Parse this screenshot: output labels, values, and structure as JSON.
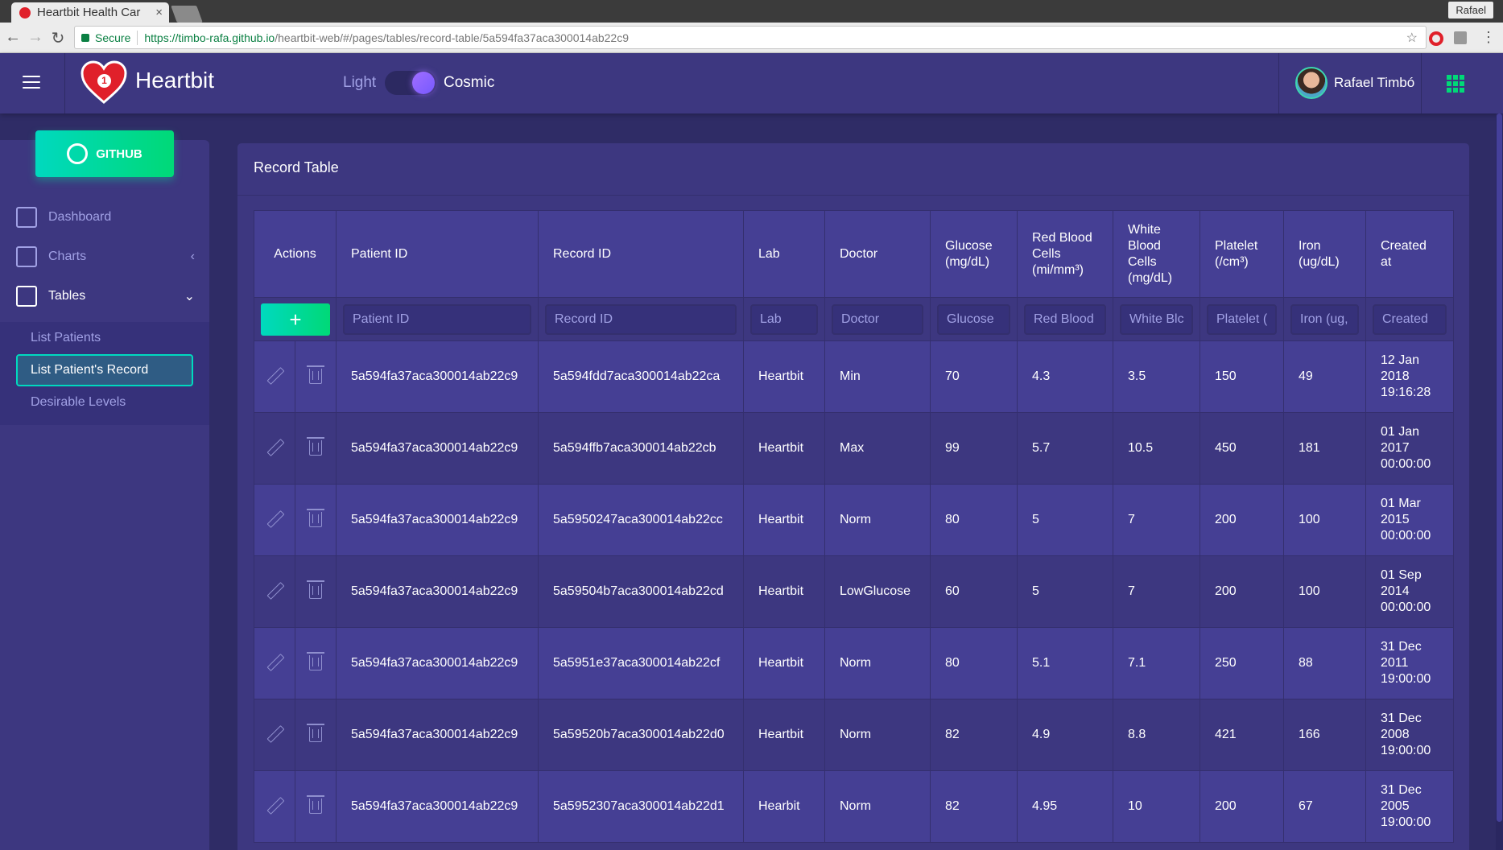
{
  "browser": {
    "tab_title": "Heartbit Health Car",
    "profile_name": "Rafael",
    "secure_label": "Secure",
    "url_origin": "https://timbo-rafa.github.io",
    "url_path": "/heartbit-web/#/pages/tables/record-table/5a594fa37aca300014ab22c9"
  },
  "header": {
    "brand": "Heartbit",
    "logo_badge": "1",
    "theme_light_label": "Light",
    "theme_cosmic_label": "Cosmic",
    "theme_selected": "Cosmic",
    "user_name": "Rafael Timbó",
    "accent_color": "#00d977"
  },
  "sidebar": {
    "github_label": "GITHUB",
    "items": [
      {
        "label": "Dashboard",
        "icon": "home-icon"
      },
      {
        "label": "Charts",
        "icon": "bar-chart-icon",
        "chevron": "‹"
      },
      {
        "label": "Tables",
        "icon": "table-icon",
        "chevron": "⌄"
      }
    ],
    "subitems": [
      {
        "label": "List Patients"
      },
      {
        "label": "List Patient's Record"
      },
      {
        "label": "Desirable Levels"
      }
    ]
  },
  "card": {
    "title": "Record Table"
  },
  "table": {
    "headers": {
      "actions": "Actions",
      "patient_id": "Patient ID",
      "record_id": "Record ID",
      "lab": "Lab",
      "doctor": "Doctor",
      "glucose": "Glucose (mg/dL)",
      "rbc": "Red Blood Cells (mi/mm³)",
      "wbc": "White Blood Cells (mg/dL)",
      "platelet": "Platelet (/cm³)",
      "iron": "Iron (ug/dL)",
      "created": "Created at"
    },
    "add_label": "+",
    "placeholders": {
      "patient_id": "Patient ID",
      "record_id": "Record ID",
      "lab": "Lab",
      "doctor": "Doctor",
      "glucose": "Glucose",
      "rbc": "Red Blood",
      "wbc": "White Blc",
      "platelet": "Platelet (",
      "iron": "Iron (ug,",
      "created": "Created"
    },
    "rows": [
      {
        "patient_id": "5a594fa37aca300014ab22c9",
        "record_id": "5a594fdd7aca300014ab22ca",
        "lab": "Heartbit",
        "doctor": "Min",
        "glucose": "70",
        "rbc": "4.3",
        "wbc": "3.5",
        "platelet": "150",
        "iron": "49",
        "created": "12 Jan 2018 19:16:28"
      },
      {
        "patient_id": "5a594fa37aca300014ab22c9",
        "record_id": "5a594ffb7aca300014ab22cb",
        "lab": "Heartbit",
        "doctor": "Max",
        "glucose": "99",
        "rbc": "5.7",
        "wbc": "10.5",
        "platelet": "450",
        "iron": "181",
        "created": "01 Jan 2017 00:00:00"
      },
      {
        "patient_id": "5a594fa37aca300014ab22c9",
        "record_id": "5a5950247aca300014ab22cc",
        "lab": "Heartbit",
        "doctor": "Norm",
        "glucose": "80",
        "rbc": "5",
        "wbc": "7",
        "platelet": "200",
        "iron": "100",
        "created": "01 Mar 2015 00:00:00"
      },
      {
        "patient_id": "5a594fa37aca300014ab22c9",
        "record_id": "5a59504b7aca300014ab22cd",
        "lab": "Heartbit",
        "doctor": "LowGlucose",
        "glucose": "60",
        "rbc": "5",
        "wbc": "7",
        "platelet": "200",
        "iron": "100",
        "created": "01 Sep 2014 00:00:00"
      },
      {
        "patient_id": "5a594fa37aca300014ab22c9",
        "record_id": "5a5951e37aca300014ab22cf",
        "lab": "Heartbit",
        "doctor": "Norm",
        "glucose": "80",
        "rbc": "5.1",
        "wbc": "7.1",
        "platelet": "250",
        "iron": "88",
        "created": "31 Dec 2011 19:00:00"
      },
      {
        "patient_id": "5a594fa37aca300014ab22c9",
        "record_id": "5a59520b7aca300014ab22d0",
        "lab": "Heartbit",
        "doctor": "Norm",
        "glucose": "82",
        "rbc": "4.9",
        "wbc": "8.8",
        "platelet": "421",
        "iron": "166",
        "created": "31 Dec 2008 19:00:00"
      },
      {
        "patient_id": "5a594fa37aca300014ab22c9",
        "record_id": "5a5952307aca300014ab22d1",
        "lab": "Hearbit",
        "doctor": "Norm",
        "glucose": "82",
        "rbc": "4.95",
        "wbc": "10",
        "platelet": "200",
        "iron": "67",
        "created": "31 Dec 2005 19:00:00"
      }
    ]
  }
}
